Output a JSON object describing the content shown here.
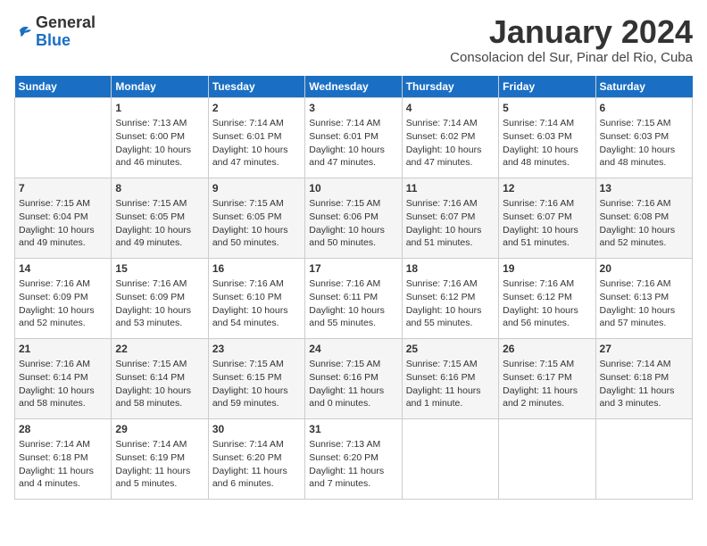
{
  "header": {
    "logo_general": "General",
    "logo_blue": "Blue",
    "month_year": "January 2024",
    "location": "Consolacion del Sur, Pinar del Rio, Cuba"
  },
  "days_of_week": [
    "Sunday",
    "Monday",
    "Tuesday",
    "Wednesday",
    "Thursday",
    "Friday",
    "Saturday"
  ],
  "weeks": [
    [
      {
        "day": "",
        "empty": true
      },
      {
        "day": "1",
        "sunrise": "Sunrise: 7:13 AM",
        "sunset": "Sunset: 6:00 PM",
        "daylight": "Daylight: 10 hours and 46 minutes."
      },
      {
        "day": "2",
        "sunrise": "Sunrise: 7:14 AM",
        "sunset": "Sunset: 6:01 PM",
        "daylight": "Daylight: 10 hours and 47 minutes."
      },
      {
        "day": "3",
        "sunrise": "Sunrise: 7:14 AM",
        "sunset": "Sunset: 6:01 PM",
        "daylight": "Daylight: 10 hours and 47 minutes."
      },
      {
        "day": "4",
        "sunrise": "Sunrise: 7:14 AM",
        "sunset": "Sunset: 6:02 PM",
        "daylight": "Daylight: 10 hours and 47 minutes."
      },
      {
        "day": "5",
        "sunrise": "Sunrise: 7:14 AM",
        "sunset": "Sunset: 6:03 PM",
        "daylight": "Daylight: 10 hours and 48 minutes."
      },
      {
        "day": "6",
        "sunrise": "Sunrise: 7:15 AM",
        "sunset": "Sunset: 6:03 PM",
        "daylight": "Daylight: 10 hours and 48 minutes."
      }
    ],
    [
      {
        "day": "7",
        "sunrise": "Sunrise: 7:15 AM",
        "sunset": "Sunset: 6:04 PM",
        "daylight": "Daylight: 10 hours and 49 minutes."
      },
      {
        "day": "8",
        "sunrise": "Sunrise: 7:15 AM",
        "sunset": "Sunset: 6:05 PM",
        "daylight": "Daylight: 10 hours and 49 minutes."
      },
      {
        "day": "9",
        "sunrise": "Sunrise: 7:15 AM",
        "sunset": "Sunset: 6:05 PM",
        "daylight": "Daylight: 10 hours and 50 minutes."
      },
      {
        "day": "10",
        "sunrise": "Sunrise: 7:15 AM",
        "sunset": "Sunset: 6:06 PM",
        "daylight": "Daylight: 10 hours and 50 minutes."
      },
      {
        "day": "11",
        "sunrise": "Sunrise: 7:16 AM",
        "sunset": "Sunset: 6:07 PM",
        "daylight": "Daylight: 10 hours and 51 minutes."
      },
      {
        "day": "12",
        "sunrise": "Sunrise: 7:16 AM",
        "sunset": "Sunset: 6:07 PM",
        "daylight": "Daylight: 10 hours and 51 minutes."
      },
      {
        "day": "13",
        "sunrise": "Sunrise: 7:16 AM",
        "sunset": "Sunset: 6:08 PM",
        "daylight": "Daylight: 10 hours and 52 minutes."
      }
    ],
    [
      {
        "day": "14",
        "sunrise": "Sunrise: 7:16 AM",
        "sunset": "Sunset: 6:09 PM",
        "daylight": "Daylight: 10 hours and 52 minutes."
      },
      {
        "day": "15",
        "sunrise": "Sunrise: 7:16 AM",
        "sunset": "Sunset: 6:09 PM",
        "daylight": "Daylight: 10 hours and 53 minutes."
      },
      {
        "day": "16",
        "sunrise": "Sunrise: 7:16 AM",
        "sunset": "Sunset: 6:10 PM",
        "daylight": "Daylight: 10 hours and 54 minutes."
      },
      {
        "day": "17",
        "sunrise": "Sunrise: 7:16 AM",
        "sunset": "Sunset: 6:11 PM",
        "daylight": "Daylight: 10 hours and 55 minutes."
      },
      {
        "day": "18",
        "sunrise": "Sunrise: 7:16 AM",
        "sunset": "Sunset: 6:12 PM",
        "daylight": "Daylight: 10 hours and 55 minutes."
      },
      {
        "day": "19",
        "sunrise": "Sunrise: 7:16 AM",
        "sunset": "Sunset: 6:12 PM",
        "daylight": "Daylight: 10 hours and 56 minutes."
      },
      {
        "day": "20",
        "sunrise": "Sunrise: 7:16 AM",
        "sunset": "Sunset: 6:13 PM",
        "daylight": "Daylight: 10 hours and 57 minutes."
      }
    ],
    [
      {
        "day": "21",
        "sunrise": "Sunrise: 7:16 AM",
        "sunset": "Sunset: 6:14 PM",
        "daylight": "Daylight: 10 hours and 58 minutes."
      },
      {
        "day": "22",
        "sunrise": "Sunrise: 7:15 AM",
        "sunset": "Sunset: 6:14 PM",
        "daylight": "Daylight: 10 hours and 58 minutes."
      },
      {
        "day": "23",
        "sunrise": "Sunrise: 7:15 AM",
        "sunset": "Sunset: 6:15 PM",
        "daylight": "Daylight: 10 hours and 59 minutes."
      },
      {
        "day": "24",
        "sunrise": "Sunrise: 7:15 AM",
        "sunset": "Sunset: 6:16 PM",
        "daylight": "Daylight: 11 hours and 0 minutes."
      },
      {
        "day": "25",
        "sunrise": "Sunrise: 7:15 AM",
        "sunset": "Sunset: 6:16 PM",
        "daylight": "Daylight: 11 hours and 1 minute."
      },
      {
        "day": "26",
        "sunrise": "Sunrise: 7:15 AM",
        "sunset": "Sunset: 6:17 PM",
        "daylight": "Daylight: 11 hours and 2 minutes."
      },
      {
        "day": "27",
        "sunrise": "Sunrise: 7:14 AM",
        "sunset": "Sunset: 6:18 PM",
        "daylight": "Daylight: 11 hours and 3 minutes."
      }
    ],
    [
      {
        "day": "28",
        "sunrise": "Sunrise: 7:14 AM",
        "sunset": "Sunset: 6:18 PM",
        "daylight": "Daylight: 11 hours and 4 minutes."
      },
      {
        "day": "29",
        "sunrise": "Sunrise: 7:14 AM",
        "sunset": "Sunset: 6:19 PM",
        "daylight": "Daylight: 11 hours and 5 minutes."
      },
      {
        "day": "30",
        "sunrise": "Sunrise: 7:14 AM",
        "sunset": "Sunset: 6:20 PM",
        "daylight": "Daylight: 11 hours and 6 minutes."
      },
      {
        "day": "31",
        "sunrise": "Sunrise: 7:13 AM",
        "sunset": "Sunset: 6:20 PM",
        "daylight": "Daylight: 11 hours and 7 minutes."
      },
      {
        "day": "",
        "empty": true
      },
      {
        "day": "",
        "empty": true
      },
      {
        "day": "",
        "empty": true
      }
    ]
  ]
}
